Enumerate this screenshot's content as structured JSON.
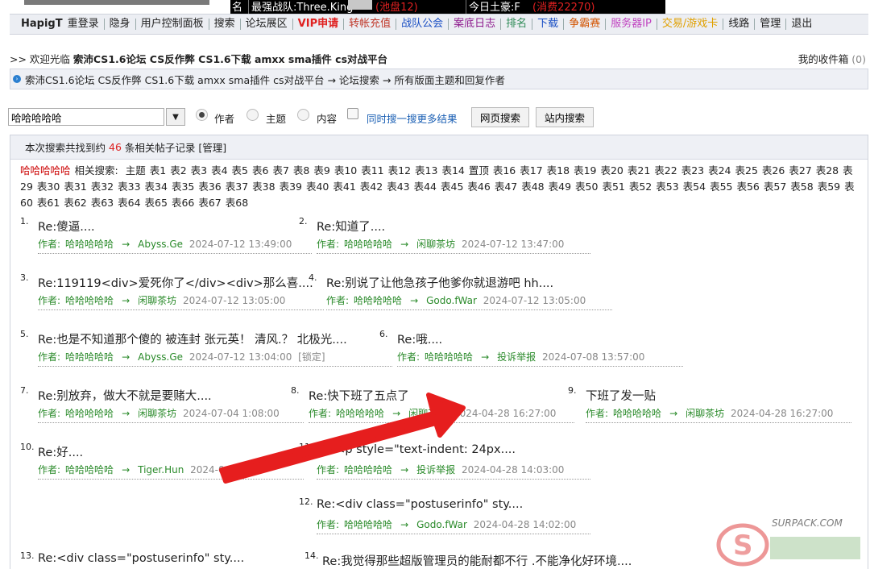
{
  "topbar": {
    "cell_name": "名",
    "strongest_team": "最强战队:Three.King",
    "strongest_team_note": "(池盘12)",
    "today_master": "今日土豪:F",
    "today_master_note": "(消费22270)"
  },
  "nav": [
    {
      "label": "HapigT",
      "color": "#222222",
      "bold": true,
      "suffix": "重登录"
    },
    {
      "label": "隐身",
      "color": "#222222"
    },
    {
      "label": "用户控制面板",
      "color": "#222222"
    },
    {
      "label": "搜索",
      "color": "#222222"
    },
    {
      "label": "论坛展区",
      "color": "#222222"
    },
    {
      "label": "VIP申请",
      "color": "#e02020",
      "bold": true
    },
    {
      "label": "转帐充值",
      "color": "#c0392b"
    },
    {
      "label": "战队公会",
      "color": "#1a4fc4"
    },
    {
      "label": "案底日志",
      "color": "#8e1b8e"
    },
    {
      "label": "排名",
      "color": "#2e8b57"
    },
    {
      "label": "下载",
      "color": "#1a4fc4"
    },
    {
      "label": "争霸赛",
      "color": "#d35400"
    },
    {
      "label": "服务器IP",
      "color": "#c043c0"
    },
    {
      "label": "交易/游戏卡",
      "color": "#e0a000"
    },
    {
      "label": "线路",
      "color": "#222222"
    },
    {
      "label": "管理",
      "color": "#222222"
    },
    {
      "label": "退出",
      "color": "#222222"
    }
  ],
  "welcome": {
    "prefix": ">> 欢迎光临",
    "site": "索沛CS1.6论坛 CS反作弊 CS1.6下载 amxx sma插件 cs对战平台",
    "inbox_label": "我的收件箱",
    "inbox_count": "(0)"
  },
  "breadcrumb": "索沛CS1.6论坛 CS反作弊 CS1.6下载 amxx sma插件 cs对战平台 → 论坛搜索 → 所有版面主题和回复作者",
  "search": {
    "value": "哈哈哈哈哈",
    "dropdown_glyph": "▼",
    "radio_author": "作者",
    "radio_subject": "主题",
    "radio_content": "内容",
    "also_search": "同时搜一搜更多结果",
    "web_search": "网页搜索",
    "site_search": "站内搜索"
  },
  "results": {
    "summary_pre": "本次搜索共找到约",
    "count": "46",
    "summary_post": "条相关帖子记录 [管理]",
    "keyword": "哈哈哈哈哈",
    "related_label": "相关搜索:",
    "related_tags": [
      "主题",
      "表1",
      "表2",
      "表3",
      "表4",
      "表5",
      "表6",
      "表7",
      "表8",
      "表9",
      "表10",
      "表11",
      "表12",
      "表13",
      "表14",
      "置顶",
      "表16",
      "表17",
      "表18",
      "表19",
      "表20",
      "表21",
      "表22",
      "表23",
      "表24",
      "表25",
      "表26",
      "表27",
      "表28",
      "表29",
      "表30",
      "表31",
      "表32",
      "表33",
      "表34",
      "表35",
      "表36",
      "表37",
      "表38",
      "表39",
      "表40",
      "表41",
      "表42",
      "表43",
      "表44",
      "表45",
      "表46",
      "表47",
      "表48",
      "表49",
      "表50",
      "表51",
      "表52",
      "表53",
      "表54",
      "表55",
      "表56",
      "表57",
      "表58",
      "表59",
      "表60",
      "表61",
      "表62",
      "表63",
      "表64",
      "表65",
      "表66",
      "表67",
      "表68"
    ]
  },
  "posts": [
    {
      "num": "1.",
      "title": "Re:傻逼....",
      "author_label": "作者:",
      "author": "哈哈哈哈哈",
      "arrow": "→",
      "board": "Abyss.Ge",
      "time": "2024-07-12 13:49:00",
      "extra": ""
    },
    {
      "num": "2.",
      "title": "Re:知道了....",
      "author_label": "作者:",
      "author": "哈哈哈哈哈",
      "arrow": "→",
      "board": "闲聊茶坊",
      "time": "2024-07-12 13:47:00",
      "extra": ""
    },
    {
      "num": "3.",
      "title": "Re:119119<div>爱死你了</div><div>那么喜....",
      "author_label": "作者:",
      "author": "哈哈哈哈哈",
      "arrow": "→",
      "board": "闲聊茶坊",
      "time": "2024-07-12 13:05:00",
      "extra": ""
    },
    {
      "num": "4.",
      "title": "Re:别说了让他急孩子他爹你就退游吧 hh....",
      "author_label": "作者:",
      "author": "哈哈哈哈哈",
      "arrow": "→",
      "board": "Godo.fWar",
      "time": "2024-07-12 13:05:00",
      "extra": ""
    },
    {
      "num": "5.",
      "title": "Re:也是不知道那个傻的 被连封 张元英！ 清风.？ 北极光....",
      "author_label": "作者:",
      "author": "哈哈哈哈哈",
      "arrow": "→",
      "board": "Abyss.Ge",
      "time": "2024-07-12 13:04:00",
      "extra": "[锁定]"
    },
    {
      "num": "6.",
      "title": "Re:哦....",
      "author_label": "作者:",
      "author": "哈哈哈哈哈",
      "arrow": "→",
      "board": "投诉举报",
      "time": "2024-07-08 13:57:00",
      "extra": ""
    },
    {
      "num": "7.",
      "title": "Re:别放弃，做大不就是要赌大....",
      "author_label": "作者:",
      "author": "哈哈哈哈哈",
      "arrow": "→",
      "board": "闲聊茶坊",
      "time": "2024-07-04 1:08:00",
      "extra": ""
    },
    {
      "num": "8.",
      "title": "Re:快下班了五点了",
      "author_label": "作者:",
      "author": "哈哈哈哈哈",
      "arrow": "→",
      "board": "闲聊茶坊",
      "time": "2024-04-28 16:27:00",
      "extra": ""
    },
    {
      "num": "9.",
      "title": "下班了发一贴",
      "author_label": "作者:",
      "author": "哈哈哈哈哈",
      "arrow": "→",
      "board": "闲聊茶坊",
      "time": "2024-04-28 16:27:00",
      "extra": ""
    },
    {
      "num": "10.",
      "title": "Re:好....",
      "author_label": "作者:",
      "author": "哈哈哈哈哈",
      "arrow": "→",
      "board": "Tiger.Hun",
      "time": "2024-04-28",
      "extra": ""
    },
    {
      "num": "11.",
      "title": "Re:<p style=\"text-indent: 24px....",
      "author_label": "作者:",
      "author": "哈哈哈哈哈",
      "arrow": "→",
      "board": "投诉举报",
      "time": "2024-04-28 14:03:00",
      "extra": ""
    },
    {
      "num": "12.",
      "title": "Re:<div class=\"postuserinfo\" sty....",
      "author_label": "作者:",
      "author": "哈哈哈哈哈",
      "arrow": "→",
      "board": "Godo.fWar",
      "time": "2024-04-28 14:02:00",
      "extra": ""
    },
    {
      "num": "13.",
      "title": "Re:<div class=\"postuserinfo\" sty....",
      "author_label": "",
      "author": "",
      "arrow": "",
      "board": "",
      "time": "",
      "extra": ""
    },
    {
      "num": "14.",
      "title": "Re:我觉得那些超版管理员的能耐都不行 .不能净化好环境....",
      "author_label": "",
      "author": "",
      "arrow": "",
      "board": "",
      "time": "",
      "extra": ""
    }
  ],
  "watermark": {
    "text": "SURPACK.COM"
  },
  "colors": {
    "link_green": "#2a8a2a",
    "keyword_red": "#cc0000",
    "arrow_red": "#e61e1e",
    "nav_bg": "#eceef3"
  }
}
